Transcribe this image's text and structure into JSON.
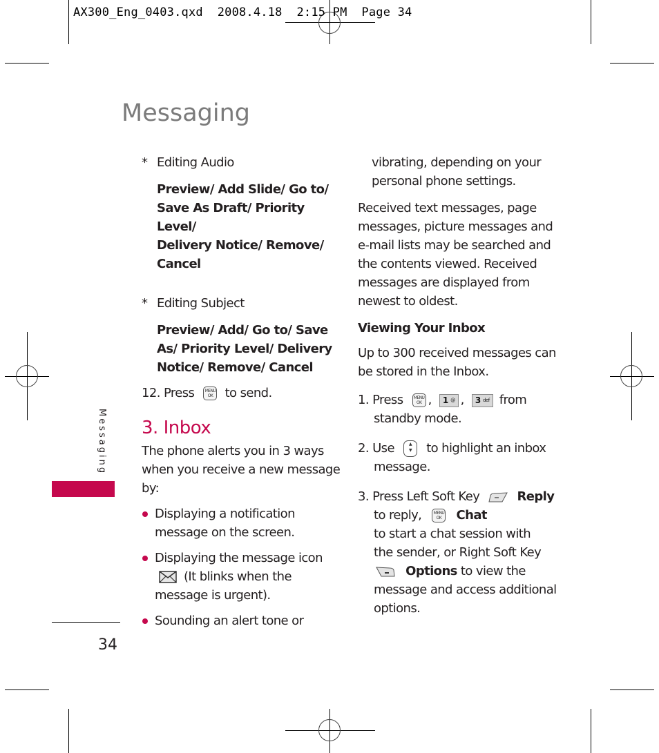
{
  "slug": {
    "text": "AX300_Eng_0403.qxd  2008.4.18  2:15 PM  Page 34"
  },
  "page": {
    "title": "Messaging",
    "side_tab_label": "Messaging",
    "page_number": "34",
    "accent_color": "#c5084d"
  },
  "left_column": {
    "editing_audio": {
      "label": "Editing Audio",
      "marker": "*",
      "options": "Preview/ Add Slide/ Go to/ Save As Draft/ Priority Level/ Delivery Notice/ Remove/ Cancel",
      "lines": [
        "Preview/ Add Slide/ Go to/",
        "Save As Draft/ Priority Level/",
        "Delivery Notice/ Remove/",
        "Cancel"
      ]
    },
    "editing_subject": {
      "label": "Editing Subject",
      "marker": "*",
      "lines": [
        "Preview/ Add/ Go to/ Save",
        "As/ Priority Level/ Delivery",
        "Notice/ Remove/ Cancel"
      ]
    },
    "step12": {
      "prefix": "12. Press",
      "key_icon": "menu-ok-key-icon",
      "suffix": "to send."
    },
    "section": {
      "heading": "3. Inbox",
      "intro_lines": [
        "The phone alerts you in 3 ways",
        "when you receive a new message",
        "by:"
      ],
      "bullets": [
        {
          "lines": [
            "Displaying a notification",
            "message on the screen."
          ]
        },
        {
          "line1": "Displaying the message icon",
          "icon": "envelope-icon",
          "line2": "(It blinks when the",
          "line3": "message is urgent)."
        },
        {
          "lines": [
            "Sounding an alert tone or"
          ]
        }
      ]
    }
  },
  "right_column": {
    "bullet_continuation": [
      "vibrating, depending on your",
      "personal phone settings."
    ],
    "paragraph": [
      "Received text messages, page",
      "messages, picture messages and",
      "e-mail lists may be searched and",
      "the contents viewed. Received",
      "messages are displayed from",
      "newest to oldest."
    ],
    "subheading": "Viewing Your Inbox",
    "capacity": [
      "Up to 300 received messages can",
      "be stored in the Inbox."
    ],
    "steps": [
      {
        "num": "1.",
        "text_a": "Press",
        "keys": [
          {
            "icon": "menu-ok-key-icon",
            "top": "MENU",
            "bottom": "OK"
          },
          {
            "icon": "key-1-icon",
            "digit": "1",
            "sub": "@"
          },
          {
            "icon": "key-3-icon",
            "digit": "3",
            "sub": "def"
          }
        ],
        "sep": ",",
        "text_b": "from",
        "line2": "standby mode."
      },
      {
        "num": "2.",
        "text_a": "Use",
        "key_icon": "nav-up-down-key-icon",
        "text_b": "to highlight an inbox",
        "line2": "message."
      },
      {
        "num": "3.",
        "text_a": "Press Left Soft Key",
        "left_soft_icon": "left-soft-key-icon",
        "reply": "Reply",
        "to_reply": "to reply,",
        "chat": "Chat",
        "line3": "to start a chat session with",
        "line4": "the sender, or Right Soft Key",
        "right_soft_icon": "right-soft-key-icon",
        "options": "Options",
        "to_view": "to view the",
        "line6": "message and access additional",
        "line7": "options."
      }
    ]
  }
}
